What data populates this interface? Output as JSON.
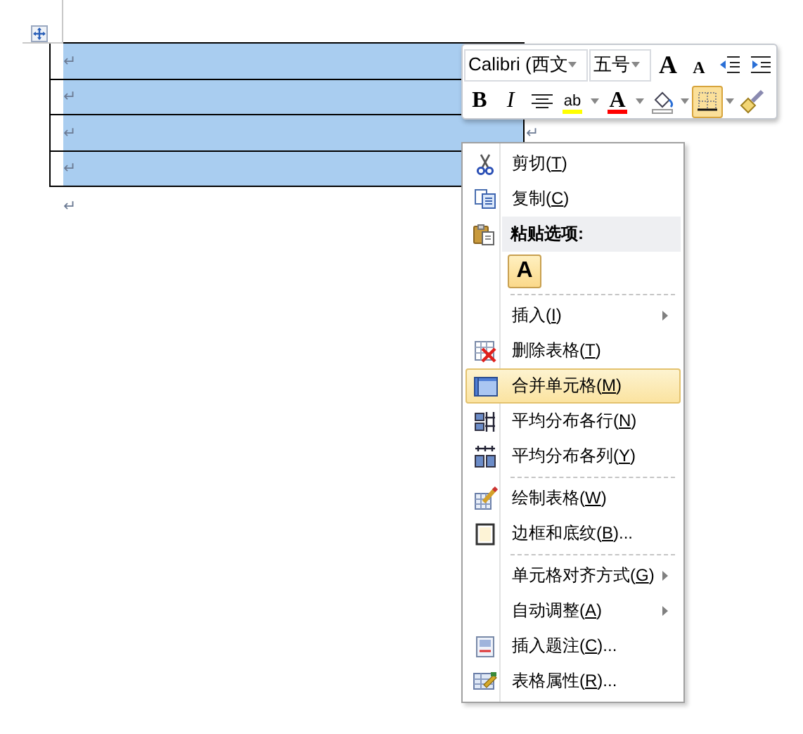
{
  "table": {
    "rows": [
      {
        "mark": "↵",
        "selected": true
      },
      {
        "mark": "↵",
        "selected": true
      },
      {
        "mark": "↵",
        "selected": true,
        "end_mark": "↵"
      },
      {
        "mark": "↵",
        "selected": true
      }
    ],
    "after_mark": "↵"
  },
  "mini_toolbar": {
    "font": {
      "value": "Calibri (西文"
    },
    "size": {
      "value": "五号"
    },
    "row_1": [
      {
        "kind": "glyph",
        "text": "A",
        "pressed": false
      },
      {
        "kind": "glyph",
        "text": "A",
        "pressed": false
      },
      {
        "kind": "icon",
        "pressed": false
      },
      {
        "kind": "icon",
        "pressed": false
      }
    ],
    "row_2": [
      {
        "kind": "glyph",
        "text": "B",
        "pressed": false
      },
      {
        "kind": "glyph",
        "text": "I",
        "pressed": false
      },
      {
        "kind": "icon",
        "pressed": false
      },
      {
        "kind": "glyph",
        "text": "ab",
        "color": "#ffff00",
        "pressed": false
      },
      {
        "kind": "dropdown"
      },
      {
        "kind": "glyph",
        "text": "A",
        "color": "#ff0000",
        "pressed": false
      },
      {
        "kind": "dropdown"
      },
      {
        "kind": "icon",
        "pressed": false
      },
      {
        "kind": "dropdown"
      },
      {
        "kind": "icon",
        "pressed": true
      },
      {
        "kind": "dropdown"
      },
      {
        "kind": "icon",
        "pressed": false
      }
    ]
  },
  "context_menu": {
    "items": [
      {
        "kind": "item",
        "before": "剪切(",
        "key": "T",
        "after": ")",
        "submenu": false,
        "selected": false
      },
      {
        "kind": "item",
        "before": "复制(",
        "key": "C",
        "after": ")",
        "submenu": false,
        "selected": false
      },
      {
        "kind": "heading",
        "text": "粘贴选项:"
      },
      {
        "kind": "paste_options",
        "text": "A"
      },
      {
        "kind": "separator"
      },
      {
        "kind": "item",
        "before": "插入(",
        "key": "I",
        "after": ")",
        "submenu": true,
        "selected": false
      },
      {
        "kind": "item",
        "before": "删除表格(",
        "key": "T",
        "after": ")",
        "submenu": false,
        "selected": false
      },
      {
        "kind": "item",
        "before": "合并单元格(",
        "key": "M",
        "after": ")",
        "submenu": false,
        "selected": true
      },
      {
        "kind": "item",
        "before": "平均分布各行(",
        "key": "N",
        "after": ")",
        "submenu": false,
        "selected": false
      },
      {
        "kind": "item",
        "before": "平均分布各列(",
        "key": "Y",
        "after": ")",
        "submenu": false,
        "selected": false
      },
      {
        "kind": "separator"
      },
      {
        "kind": "item",
        "before": "绘制表格(",
        "key": "W",
        "after": ")",
        "submenu": false,
        "selected": false
      },
      {
        "kind": "item",
        "before": "边框和底纹(",
        "key": "B",
        "after": ")...",
        "submenu": false,
        "selected": false
      },
      {
        "kind": "separator"
      },
      {
        "kind": "item",
        "before": "单元格对齐方式(",
        "key": "G",
        "after": ")",
        "submenu": true,
        "selected": false
      },
      {
        "kind": "item",
        "before": "自动调整(",
        "key": "A",
        "after": ")",
        "submenu": true,
        "selected": false
      },
      {
        "kind": "item",
        "before": "插入题注(",
        "key": "C",
        "after": ")...",
        "submenu": false,
        "selected": false
      },
      {
        "kind": "item",
        "before": "表格属性(",
        "key": "R",
        "after": ")...",
        "submenu": false,
        "selected": false
      }
    ]
  }
}
